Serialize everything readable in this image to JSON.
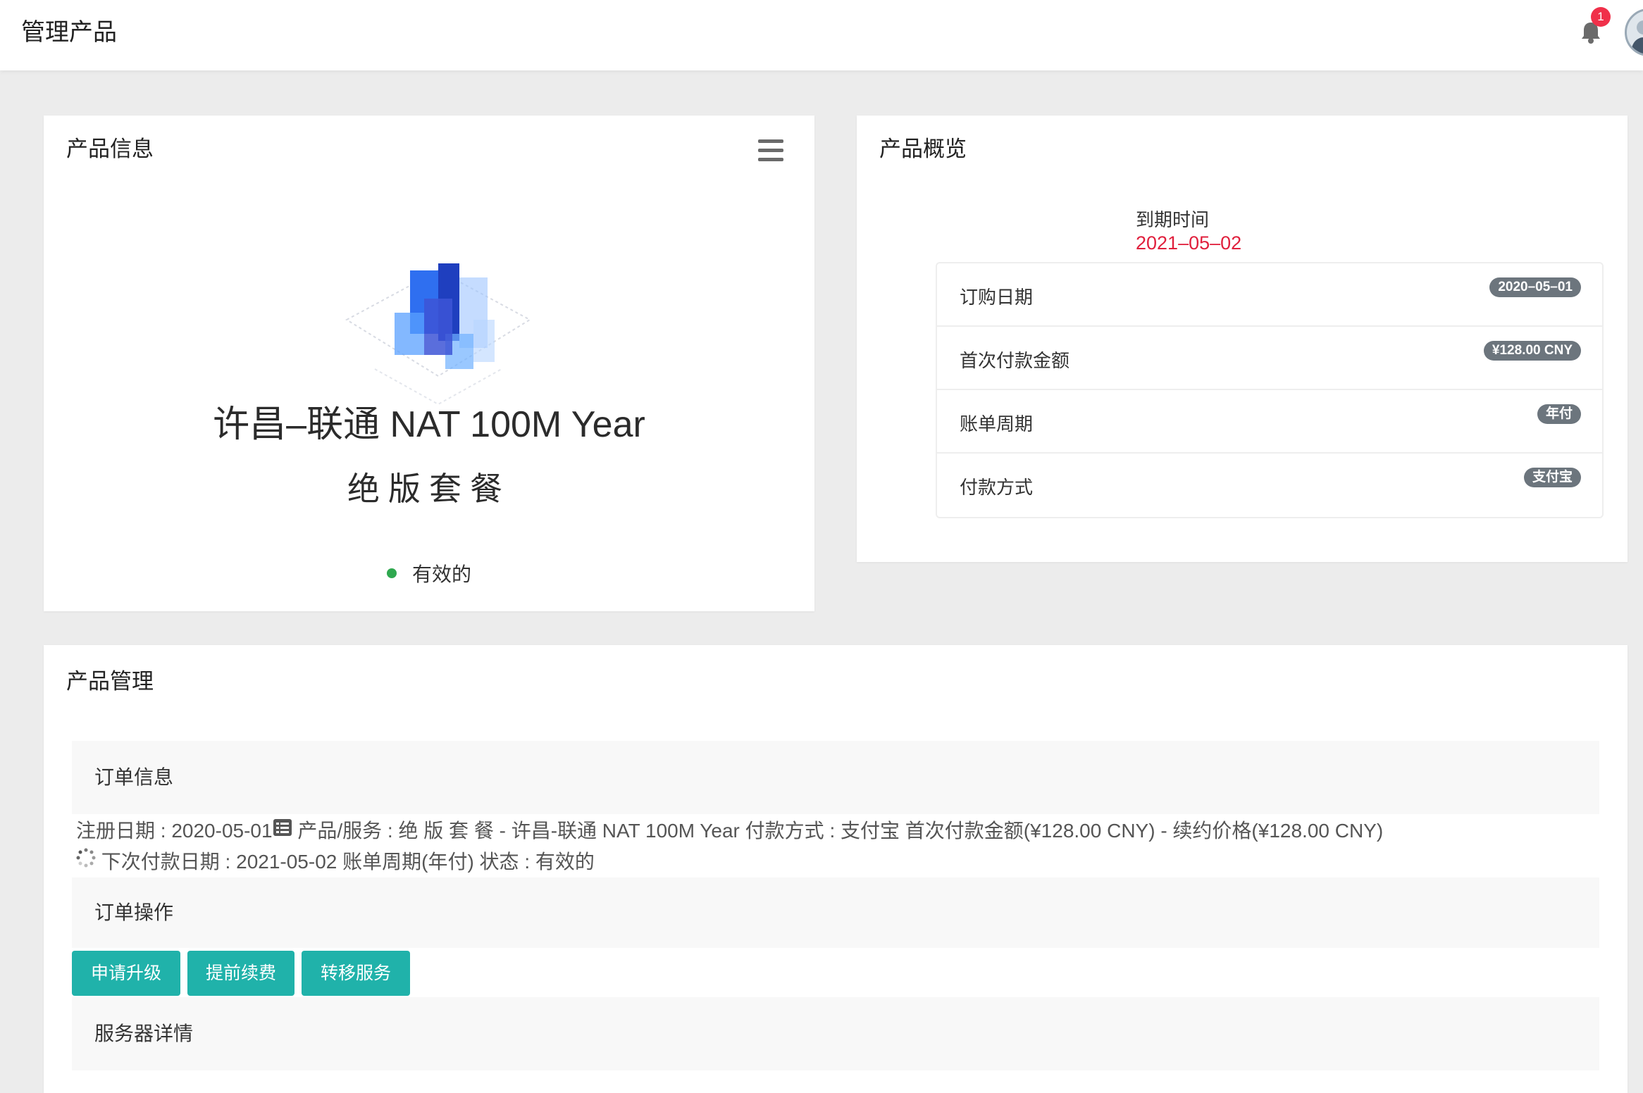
{
  "header": {
    "title": "管理产品",
    "notification_count": "1",
    "bell_icon": "bell-icon",
    "avatar_icon": "user-avatar"
  },
  "product_info": {
    "title": "产品信息",
    "menu_icon": "hamburger-menu-icon",
    "logo_icon": "product-cube-logo",
    "name": "许昌–联通 NAT 100M Year",
    "subtitle": "绝版套餐",
    "status": "有效的",
    "status_color": "#2fa84f"
  },
  "overview": {
    "title": "产品概览",
    "expire_label": "到期时间",
    "expire_value": "2021–05–02",
    "expire_color": "#e0203d",
    "rows": [
      {
        "label": "订购日期",
        "value": "2020–05–01"
      },
      {
        "label": "首次付款金额",
        "value": "¥128.00 CNY"
      },
      {
        "label": "账单周期",
        "value": "年付"
      },
      {
        "label": "付款方式",
        "value": "支付宝"
      }
    ]
  },
  "management": {
    "title": "产品管理",
    "order_info_title": "订单信息",
    "detail_line_1": "注册日期 : 2020-05-01",
    "detail_line_1b": " 产品/服务 : 绝 版 套 餐 - 许昌-联通 NAT 100M Year 付款方式 : 支付宝 首次付款金额(¥128.00 CNY) - 续约价格(¥128.00 CNY)",
    "detail_line_2": " 下次付款日期 : 2021-05-02 账单周期(年付) 状态 : 有效的",
    "order_ops_title": "订单操作",
    "buttons": [
      "申请升级",
      "提前续费",
      "转移服务"
    ],
    "button_color": "#20b2aa",
    "server_details_title": "服务器详情"
  }
}
